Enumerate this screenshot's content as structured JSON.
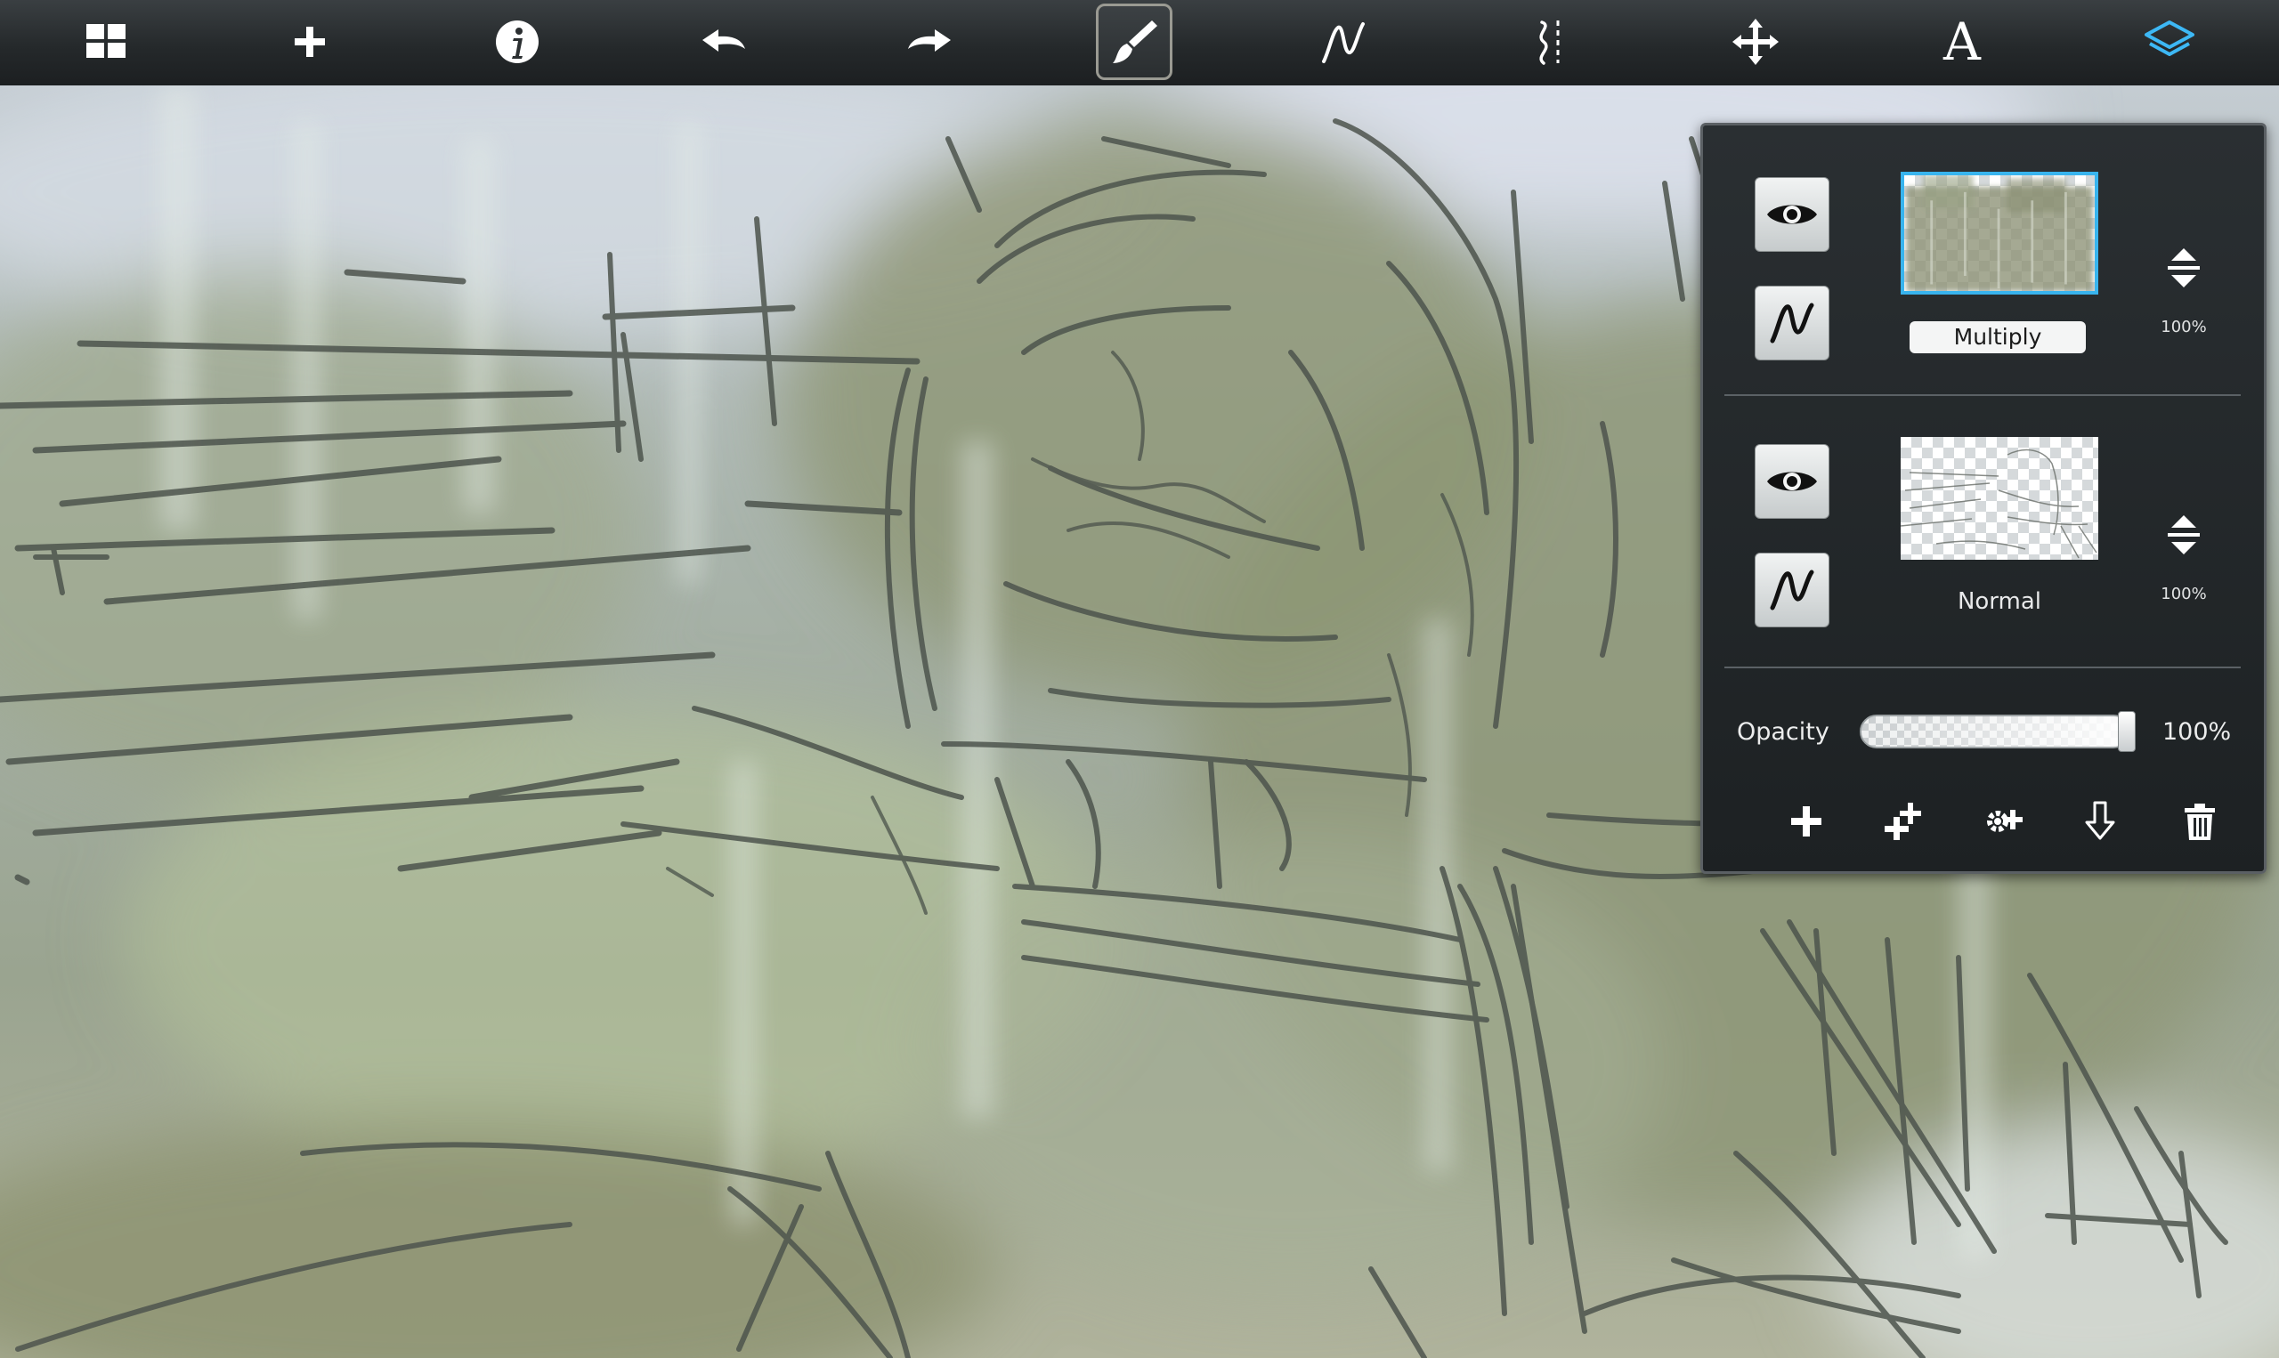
{
  "toolbar": {
    "tools": [
      {
        "name": "gallery-grid-icon"
      },
      {
        "name": "new-sketch-plus-icon"
      },
      {
        "name": "info-icon"
      },
      {
        "name": "undo-arrow-icon"
      },
      {
        "name": "redo-arrow-icon"
      },
      {
        "name": "brush-icon",
        "active": true
      },
      {
        "name": "stroke-curve-icon"
      },
      {
        "name": "symmetry-icon"
      },
      {
        "name": "transform-move-icon"
      },
      {
        "name": "text-icon"
      },
      {
        "name": "layers-icon"
      }
    ],
    "text_tool_glyph": "A"
  },
  "layers_panel": {
    "layers": [
      {
        "visible": true,
        "blend_mode": "Multiply",
        "opacity_label": "100%",
        "selected": true
      },
      {
        "visible": true,
        "blend_mode": "Normal",
        "opacity_label": "100%",
        "selected": false
      }
    ],
    "opacity": {
      "label": "Opacity",
      "value_text": "100%",
      "value": 1.0
    },
    "actions": [
      "add-layer-icon",
      "duplicate-layer-icon",
      "add-image-layer-icon",
      "merge-down-icon",
      "delete-layer-icon"
    ]
  },
  "colors": {
    "accent": "#3db8f5",
    "toolbar_bg": "#2b2f31",
    "panel_bg": "#23272a",
    "stroke": "#4d544d"
  }
}
